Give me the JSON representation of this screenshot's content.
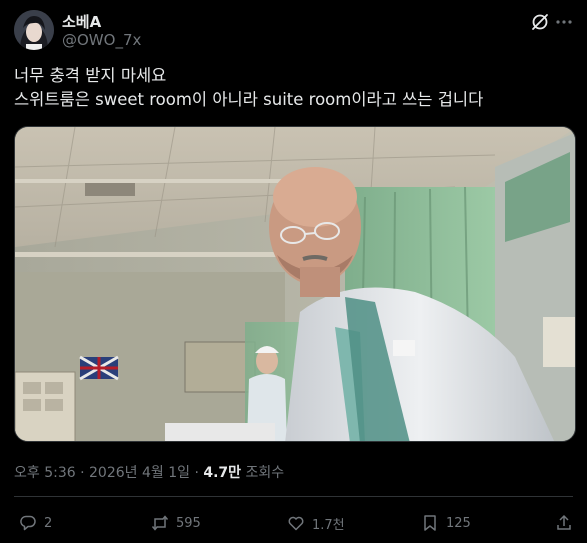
{
  "author": {
    "display_name": "소베A",
    "handle": "@OWO_7x"
  },
  "tweet": {
    "line1": "너무 충격 받지 마세요",
    "line2": "스위트룸은 sweet room이 아니라 suite room이라고 쓰는 겁니다"
  },
  "meta": {
    "time": "오후 5:36",
    "sep1": " · ",
    "date": "2026년 4월 1일",
    "sep2": " · ",
    "views_count": "4.7만",
    "views_label": " 조회수"
  },
  "actions": {
    "replies": "2",
    "reposts": "595",
    "likes": "1.7천",
    "bookmarks": "125"
  },
  "colors": {
    "background": "#000000",
    "text": "#e7e9ea",
    "muted": "#71767b",
    "divider": "#2f3336"
  },
  "icons": [
    "grok-icon",
    "more-icon",
    "reply-icon",
    "repost-icon",
    "like-icon",
    "bookmark-icon",
    "share-icon"
  ]
}
